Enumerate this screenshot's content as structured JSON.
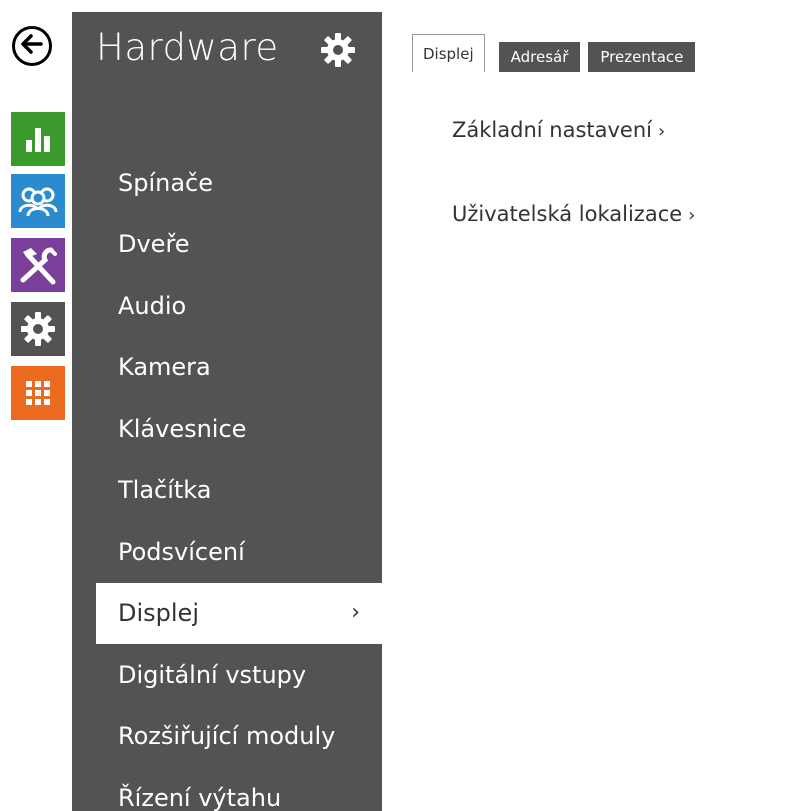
{
  "rail": {
    "back_icon": "arrow-left-icon",
    "tiles": [
      {
        "name": "status-tile",
        "icon": "bar-chart-icon",
        "color": "#3a9a2c"
      },
      {
        "name": "directory-tile",
        "icon": "users-icon",
        "color": "#2a8ccf"
      },
      {
        "name": "services-tile",
        "icon": "tools-icon",
        "color": "#7a3f99"
      },
      {
        "name": "hardware-tile",
        "icon": "gear-icon",
        "color": "#535353"
      },
      {
        "name": "system-tile",
        "icon": "grid-icon",
        "color": "#ec6a1e"
      }
    ]
  },
  "sidebar": {
    "title": "Hardware",
    "title_icon": "gear-icon",
    "items": [
      {
        "label": "Spínače"
      },
      {
        "label": "Dveře"
      },
      {
        "label": "Audio"
      },
      {
        "label": "Kamera"
      },
      {
        "label": "Klávesnice"
      },
      {
        "label": "Tlačítka"
      },
      {
        "label": "Podsvícení"
      },
      {
        "label": "Displej",
        "active": true,
        "chevron": "›"
      },
      {
        "label": "Digitální vstupy"
      },
      {
        "label": "Rozšiřující moduly"
      },
      {
        "label": "Řízení výtahu"
      }
    ]
  },
  "main": {
    "tabs": [
      {
        "label": "Displej",
        "active": true
      },
      {
        "label": "Adresář"
      },
      {
        "label": "Prezentace"
      }
    ],
    "links": [
      {
        "label": "Základní nastavení",
        "arrow": "›"
      },
      {
        "label": "Uživatelská lokalizace",
        "arrow": "›"
      }
    ]
  },
  "colors": {
    "sidebar_bg": "#535353",
    "active_bg": "#ffffff",
    "text_dark": "#333333"
  }
}
